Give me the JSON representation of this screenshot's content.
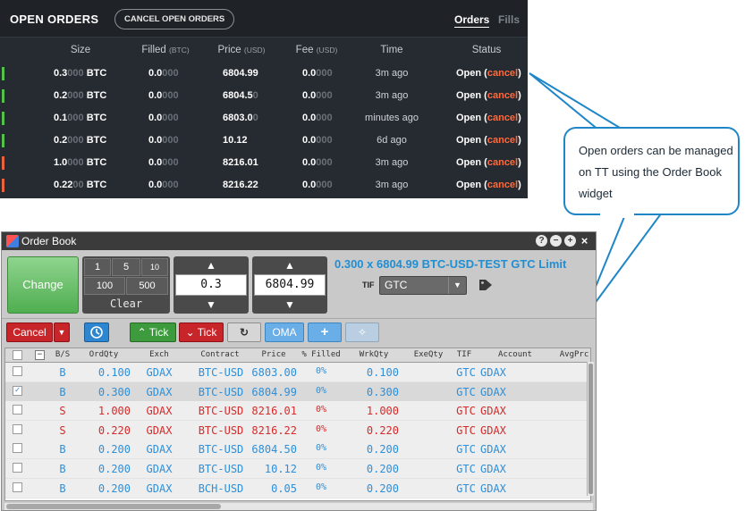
{
  "open_orders": {
    "title": "OPEN ORDERS",
    "cancel_all_label": "CANCEL OPEN ORDERS",
    "tabs": [
      {
        "label": "Orders",
        "active": true
      },
      {
        "label": "Fills",
        "active": false
      }
    ],
    "columns": {
      "size": "Size",
      "filled": "Filled",
      "filled_unit": "(BTC)",
      "price": "Price",
      "price_unit": "(USD)",
      "fee": "Fee",
      "fee_unit": "(USD)",
      "time": "Time",
      "status": "Status"
    },
    "rows": [
      {
        "side": "buy",
        "size": "0.3",
        "size_pad": "000",
        "size_unit": "BTC",
        "filled": "0.0",
        "filled_pad": "000",
        "price": "6804.99",
        "price_pad": "",
        "fee": "0.0",
        "fee_pad": "000",
        "time": "3m ago",
        "status": "Open",
        "action": "cancel"
      },
      {
        "side": "buy",
        "size": "0.2",
        "size_pad": "000",
        "size_unit": "BTC",
        "filled": "0.0",
        "filled_pad": "000",
        "price": "6804.5",
        "price_pad": "0",
        "fee": "0.0",
        "fee_pad": "000",
        "time": "3m ago",
        "status": "Open",
        "action": "cancel"
      },
      {
        "side": "buy",
        "size": "0.1",
        "size_pad": "000",
        "size_unit": "BTC",
        "filled": "0.0",
        "filled_pad": "000",
        "price": "6803.0",
        "price_pad": "0",
        "fee": "0.0",
        "fee_pad": "000",
        "time": "minutes ago",
        "status": "Open",
        "action": "cancel"
      },
      {
        "side": "buy",
        "size": "0.2",
        "size_pad": "000",
        "size_unit": "BTC",
        "filled": "0.0",
        "filled_pad": "000",
        "price": "10.12",
        "price_pad": "",
        "fee": "0.0",
        "fee_pad": "000",
        "time": "6d ago",
        "status": "Open",
        "action": "cancel"
      },
      {
        "side": "sell",
        "size": "1.0",
        "size_pad": "000",
        "size_unit": "BTC",
        "filled": "0.0",
        "filled_pad": "000",
        "price": "8216.01",
        "price_pad": "",
        "fee": "0.0",
        "fee_pad": "000",
        "time": "3m ago",
        "status": "Open",
        "action": "cancel"
      },
      {
        "side": "sell",
        "size": "0.22",
        "size_pad": "00",
        "size_unit": "BTC",
        "filled": "0.0",
        "filled_pad": "000",
        "price": "8216.22",
        "price_pad": "",
        "fee": "0.0",
        "fee_pad": "000",
        "time": "3m ago",
        "status": "Open",
        "action": "cancel"
      }
    ],
    "colors": {
      "buy_bar": "#52c24a",
      "sell_bar": "#e8643c",
      "cancel": "#ff6a3d"
    }
  },
  "callout": {
    "text": "Open orders can be managed on TT using the Order Book widget"
  },
  "order_book": {
    "title": "Order Book",
    "window_controls": [
      "?",
      "−",
      "+",
      "×"
    ],
    "change_label": "Change",
    "qty_buttons": [
      "1",
      "5",
      "10",
      "100",
      "500"
    ],
    "clear_label": "Clear",
    "qty_value": "0.3",
    "price_value": "6804.99",
    "summary": "0.300 x 6804.99 BTC-USD-TEST GTC Limit",
    "tif_label": "TIF",
    "tif_value": "GTC",
    "toolbar": {
      "cancel": "Cancel",
      "tick_up": "Tick",
      "tick_down": "Tick",
      "oma": "OMA"
    },
    "columns": [
      "B/S",
      "OrdQty",
      "Exch",
      "Contract",
      "Price",
      "% Filled",
      "WrkQty",
      "ExeQty",
      "TIF",
      "Account",
      "AvgPrc"
    ],
    "rows": [
      {
        "checked": false,
        "side": "B",
        "qty": "0.100",
        "exch": "GDAX",
        "contract": "BTC-USD",
        "price": "6803.00",
        "filled": "0%",
        "wrk": "0.100",
        "tif": "GTC",
        "account": "GDAX",
        "selected": false
      },
      {
        "checked": true,
        "side": "B",
        "qty": "0.300",
        "exch": "GDAX",
        "contract": "BTC-USD",
        "price": "6804.99",
        "filled": "0%",
        "wrk": "0.300",
        "tif": "GTC",
        "account": "GDAX",
        "selected": true
      },
      {
        "checked": false,
        "side": "S",
        "qty": "1.000",
        "exch": "GDAX",
        "contract": "BTC-USD",
        "price": "8216.01",
        "filled": "0%",
        "wrk": "1.000",
        "tif": "GTC",
        "account": "GDAX",
        "selected": false
      },
      {
        "checked": false,
        "side": "S",
        "qty": "0.220",
        "exch": "GDAX",
        "contract": "BTC-USD",
        "price": "8216.22",
        "filled": "0%",
        "wrk": "0.220",
        "tif": "GTC",
        "account": "GDAX",
        "selected": false
      },
      {
        "checked": false,
        "side": "B",
        "qty": "0.200",
        "exch": "GDAX",
        "contract": "BTC-USD",
        "price": "6804.50",
        "filled": "0%",
        "wrk": "0.200",
        "tif": "GTC",
        "account": "GDAX",
        "selected": false
      },
      {
        "checked": false,
        "side": "B",
        "qty": "0.200",
        "exch": "GDAX",
        "contract": "BTC-USD",
        "price": "10.12",
        "filled": "0%",
        "wrk": "0.200",
        "tif": "GTC",
        "account": "GDAX",
        "selected": false
      },
      {
        "checked": false,
        "side": "B",
        "qty": "0.200",
        "exch": "GDAX",
        "contract": "BCH-USD",
        "price": "0.05",
        "filled": "0%",
        "wrk": "0.200",
        "tif": "GTC",
        "account": "GDAX",
        "selected": false
      }
    ],
    "colors": {
      "buy": "#2f8fd8",
      "sell": "#d42b2b",
      "selected_row": "#d9d9d9",
      "row": "#eeeeee"
    }
  }
}
